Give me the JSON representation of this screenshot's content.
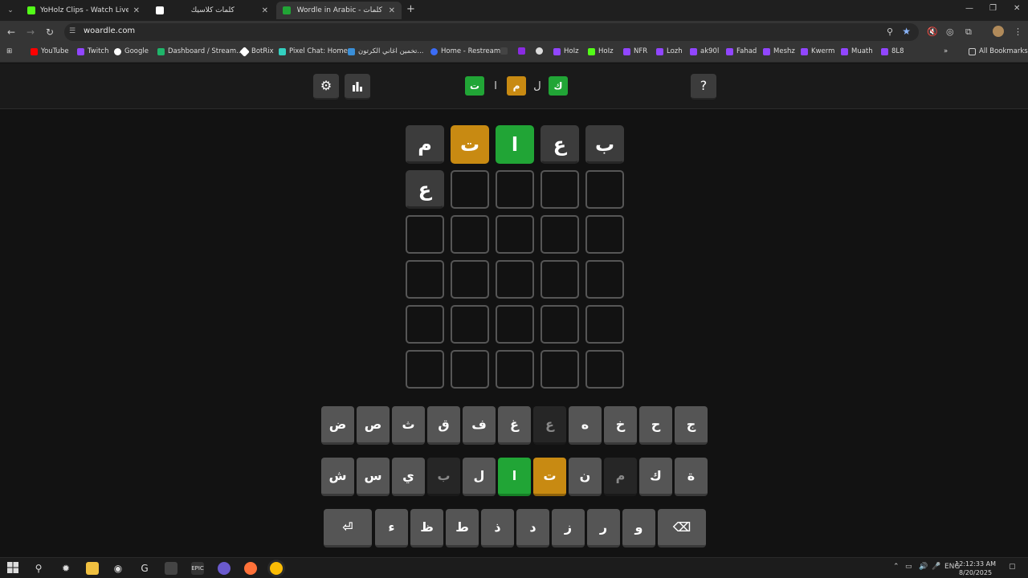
{
  "tabs": [
    {
      "title": "YoHolz Clips - Watch Live on Ki",
      "icon": "kick-icon",
      "color": "#53fc18"
    },
    {
      "title": "كلمات كلاسيك",
      "icon": "page-icon",
      "color": "#ffffff"
    },
    {
      "title": "Wordle in Arabic - كلمات",
      "icon": "wordle-icon",
      "color": "#21a536"
    }
  ],
  "url": "woardle.com",
  "bookmarks": [
    "YouTube",
    "Twitch",
    "Google",
    "Dashboard / Stream...",
    "BotRix",
    "Pixel Chat: Home",
    "تخمين اغاني الكرتون...",
    "Home - Restream",
    "HoIz",
    "HoIz",
    "NFR",
    "Lozh",
    "ak90l",
    "Fahad",
    "Meshz",
    "Kwerm",
    "Muath",
    "8L8"
  ],
  "all_bookmarks": "All Bookmarks",
  "header": {
    "help": "?",
    "logo": [
      {
        "char": "ك",
        "state": "correct"
      },
      {
        "char": "ل",
        "state": "plain"
      },
      {
        "char": "م",
        "state": "present"
      },
      {
        "char": "ا",
        "state": "plain"
      },
      {
        "char": "ت",
        "state": "correct"
      }
    ]
  },
  "board": [
    [
      {
        "l": "ب",
        "s": "filled"
      },
      {
        "l": "ع",
        "s": "filled"
      },
      {
        "l": "ا",
        "s": "correct"
      },
      {
        "l": "ت",
        "s": "present"
      },
      {
        "l": "م",
        "s": "filled"
      }
    ],
    [
      {
        "l": "",
        "s": "empty"
      },
      {
        "l": "",
        "s": "empty"
      },
      {
        "l": "",
        "s": "empty"
      },
      {
        "l": "",
        "s": "empty"
      },
      {
        "l": "ع",
        "s": "filled"
      }
    ],
    [
      {
        "l": "",
        "s": "empty"
      },
      {
        "l": "",
        "s": "empty"
      },
      {
        "l": "",
        "s": "empty"
      },
      {
        "l": "",
        "s": "empty"
      },
      {
        "l": "",
        "s": "empty"
      }
    ],
    [
      {
        "l": "",
        "s": "empty"
      },
      {
        "l": "",
        "s": "empty"
      },
      {
        "l": "",
        "s": "empty"
      },
      {
        "l": "",
        "s": "empty"
      },
      {
        "l": "",
        "s": "empty"
      }
    ],
    [
      {
        "l": "",
        "s": "empty"
      },
      {
        "l": "",
        "s": "empty"
      },
      {
        "l": "",
        "s": "empty"
      },
      {
        "l": "",
        "s": "empty"
      },
      {
        "l": "",
        "s": "empty"
      }
    ],
    [
      {
        "l": "",
        "s": "empty"
      },
      {
        "l": "",
        "s": "empty"
      },
      {
        "l": "",
        "s": "empty"
      },
      {
        "l": "",
        "s": "empty"
      },
      {
        "l": "",
        "s": "empty"
      }
    ]
  ],
  "keyboard": [
    [
      {
        "k": "ض",
        "s": ""
      },
      {
        "k": "ص",
        "s": ""
      },
      {
        "k": "ث",
        "s": ""
      },
      {
        "k": "ق",
        "s": ""
      },
      {
        "k": "ف",
        "s": ""
      },
      {
        "k": "غ",
        "s": ""
      },
      {
        "k": "ع",
        "s": "absent"
      },
      {
        "k": "ه",
        "s": ""
      },
      {
        "k": "خ",
        "s": ""
      },
      {
        "k": "ح",
        "s": ""
      },
      {
        "k": "ج",
        "s": ""
      }
    ],
    [
      {
        "k": "ش",
        "s": ""
      },
      {
        "k": "س",
        "s": ""
      },
      {
        "k": "ي",
        "s": ""
      },
      {
        "k": "ب",
        "s": "absent"
      },
      {
        "k": "ل",
        "s": ""
      },
      {
        "k": "ا",
        "s": "correct"
      },
      {
        "k": "ت",
        "s": "present"
      },
      {
        "k": "ن",
        "s": ""
      },
      {
        "k": "م",
        "s": "absent"
      },
      {
        "k": "ك",
        "s": ""
      },
      {
        "k": "ة",
        "s": ""
      }
    ],
    [
      {
        "k": "⏎",
        "s": "wide"
      },
      {
        "k": "ء",
        "s": ""
      },
      {
        "k": "ظ",
        "s": ""
      },
      {
        "k": "ط",
        "s": ""
      },
      {
        "k": "ذ",
        "s": ""
      },
      {
        "k": "د",
        "s": ""
      },
      {
        "k": "ز",
        "s": ""
      },
      {
        "k": "ر",
        "s": ""
      },
      {
        "k": "و",
        "s": ""
      },
      {
        "k": "⌫",
        "s": "wide"
      }
    ]
  ],
  "taskbar": {
    "lang": "ENG",
    "time": "12:12:33 AM",
    "date": "8/20/2025"
  }
}
